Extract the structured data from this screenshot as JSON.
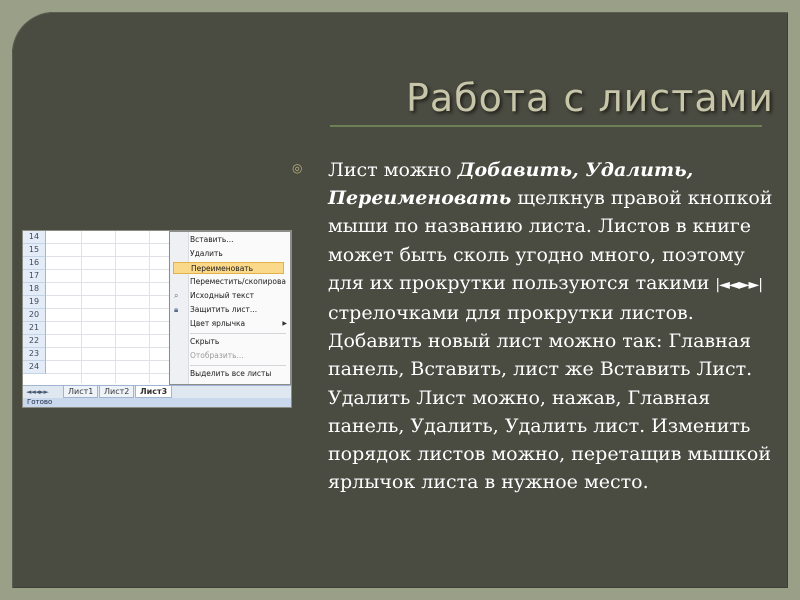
{
  "slide": {
    "title": "Работа с листами",
    "bullet_icon": "circle-bullet-icon",
    "paragraph": {
      "p1": "Лист можно ",
      "em1": "Добавить, Удалить, Переименовать",
      "p2": " щелкнув правой кнопкой мыши по названию листа. Листов в книге может быть сколь угодно много, поэтому для их прокрутки пользуются такими ",
      "arrows": "|◄◄►►|",
      "p3": " стрелочками для прокрутки листов. Добавить новый лист можно так: Главная панель, Вставить, лист же Вставить Лист. Удалить Лист можно, нажав, Главная панель, Удалить, Удалить лист. Изменить порядок листов можно, перетащив мышкой ярлычок листа в нужное место."
    }
  },
  "excel": {
    "rows": [
      "14",
      "15",
      "16",
      "17",
      "18",
      "19",
      "20",
      "21",
      "22",
      "23",
      "24"
    ],
    "tabs": [
      "Лист1",
      "Лист2",
      "Лист3"
    ],
    "tab_nav": "◄◄◄►►",
    "status": "Готово",
    "menu": {
      "insert": "Вставить...",
      "delete": "Удалить",
      "rename": "Переименовать",
      "move_copy": "Переместить/скопировать...",
      "view_code": "Исходный текст",
      "protect": "Защитить лист...",
      "tab_color": "Цвет ярлычка",
      "hide": "Скрыть",
      "unhide": "Отобразить...",
      "select_all": "Выделить все листы"
    }
  },
  "colors": {
    "background": "#9a9f87",
    "slide": "#4a4b41",
    "title": "#c7c6a9",
    "rule": "#6e7f55",
    "menu_highlight": "#fbd98a"
  }
}
